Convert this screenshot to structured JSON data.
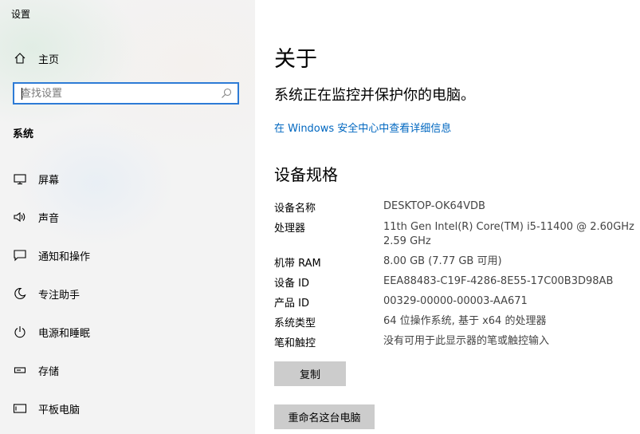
{
  "app": {
    "title": "设置"
  },
  "sidebar": {
    "home_label": "主页",
    "search": {
      "placeholder": "查找设置",
      "value": ""
    },
    "section": "系统",
    "items": [
      {
        "label": "屏幕",
        "icon": "display-icon"
      },
      {
        "label": "声音",
        "icon": "speaker-icon"
      },
      {
        "label": "通知和操作",
        "icon": "notification-icon"
      },
      {
        "label": "专注助手",
        "icon": "moon-icon"
      },
      {
        "label": "电源和睡眠",
        "icon": "power-icon"
      },
      {
        "label": "存储",
        "icon": "storage-icon"
      },
      {
        "label": "平板电脑",
        "icon": "tablet-icon"
      }
    ]
  },
  "main": {
    "title": "关于",
    "status": "系统正在监控并保护你的电脑。",
    "security_link": "在 Windows 安全中心中查看详细信息",
    "specs_title": "设备规格",
    "specs": [
      {
        "label": "设备名称",
        "value": "DESKTOP-OK64VDB"
      },
      {
        "label": "处理器",
        "value": "11th Gen Intel(R) Core(TM) i5-11400 @ 2.60GHz",
        "value2": "2.59 GHz"
      },
      {
        "label": "机带 RAM",
        "value": "8.00 GB (7.77 GB 可用)"
      },
      {
        "label": "设备 ID",
        "value": "EEA88483-C19F-4286-8E55-17C00B3D98AB"
      },
      {
        "label": "产品 ID",
        "value": "00329-00000-00003-AA671"
      },
      {
        "label": "系统类型",
        "value": "64 位操作系统, 基于 x64 的处理器"
      },
      {
        "label": "笔和触控",
        "value": "没有可用于此显示器的笔或触控输入"
      }
    ],
    "copy_button": "复制",
    "rename_button": "重命名这台电脑"
  },
  "colors": {
    "accent": "#0067c0",
    "search_border": "#2d7bd6",
    "button_bg": "#cccccc"
  }
}
